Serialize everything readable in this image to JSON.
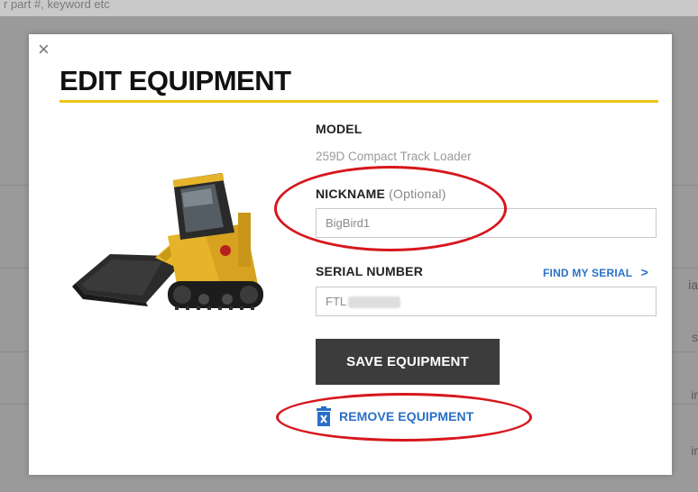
{
  "background": {
    "search_placeholder": "r part #, keyword etc",
    "right_text": [
      "ia",
      "s",
      "ir",
      "ir"
    ]
  },
  "modal": {
    "close_symbol": "×",
    "title": "EDIT EQUIPMENT",
    "model": {
      "label": "MODEL",
      "value": "259D Compact Track Loader"
    },
    "nickname": {
      "label": "NICKNAME",
      "optional": "(Optional)",
      "value": "BigBird1"
    },
    "serial": {
      "label": "SERIAL NUMBER",
      "value": "FTL",
      "find_link": "FIND MY SERIAL",
      "find_chevron": ">"
    },
    "save_button": "SAVE EQUIPMENT",
    "remove_link": "REMOVE EQUIPMENT",
    "remove_icon": "trash-icon"
  },
  "colors": {
    "accent_yellow": "#f2c317",
    "link_blue": "#2a72c8",
    "button_dark": "#3c3c3c",
    "annotation_red": "#d6171d"
  }
}
